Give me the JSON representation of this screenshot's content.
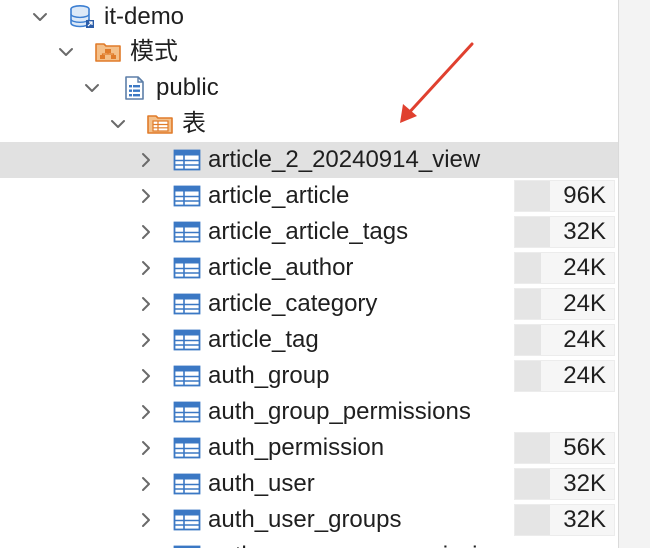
{
  "tree": {
    "connection": {
      "label": "it-demo",
      "icon": "database-icon"
    },
    "schemas_folder": {
      "label": "模式",
      "icon": "schema-folder-icon"
    },
    "schema": {
      "label": "public",
      "icon": "schema-icon"
    },
    "tables_folder": {
      "label": "表",
      "icon": "table-folder-icon"
    },
    "tables": [
      {
        "name": "article_2_20240914_view",
        "size": "",
        "size_fraction": 0,
        "selected": true
      },
      {
        "name": "article_article",
        "size": "96K",
        "size_fraction": 0.35
      },
      {
        "name": "article_article_tags",
        "size": "32K",
        "size_fraction": 0.35
      },
      {
        "name": "article_author",
        "size": "24K",
        "size_fraction": 0.26
      },
      {
        "name": "article_category",
        "size": "24K",
        "size_fraction": 0.26
      },
      {
        "name": "article_tag",
        "size": "24K",
        "size_fraction": 0.26
      },
      {
        "name": "auth_group",
        "size": "24K",
        "size_fraction": 0.26
      },
      {
        "name": "auth_group_permissions",
        "size": "",
        "size_fraction": 0
      },
      {
        "name": "auth_permission",
        "size": "56K",
        "size_fraction": 0.35
      },
      {
        "name": "auth_user",
        "size": "32K",
        "size_fraction": 0.35
      },
      {
        "name": "auth_user_groups",
        "size": "32K",
        "size_fraction": 0.35
      },
      {
        "name": "auth_user_user_permissions",
        "size": "",
        "size_fraction": 0
      }
    ]
  },
  "colors": {
    "selection": "#e1e1e1",
    "folder_orange": "#e07b2a",
    "table_blue": "#3b78c4",
    "db_blue": "#3c7fd2",
    "arrow_red": "#e0402f"
  }
}
